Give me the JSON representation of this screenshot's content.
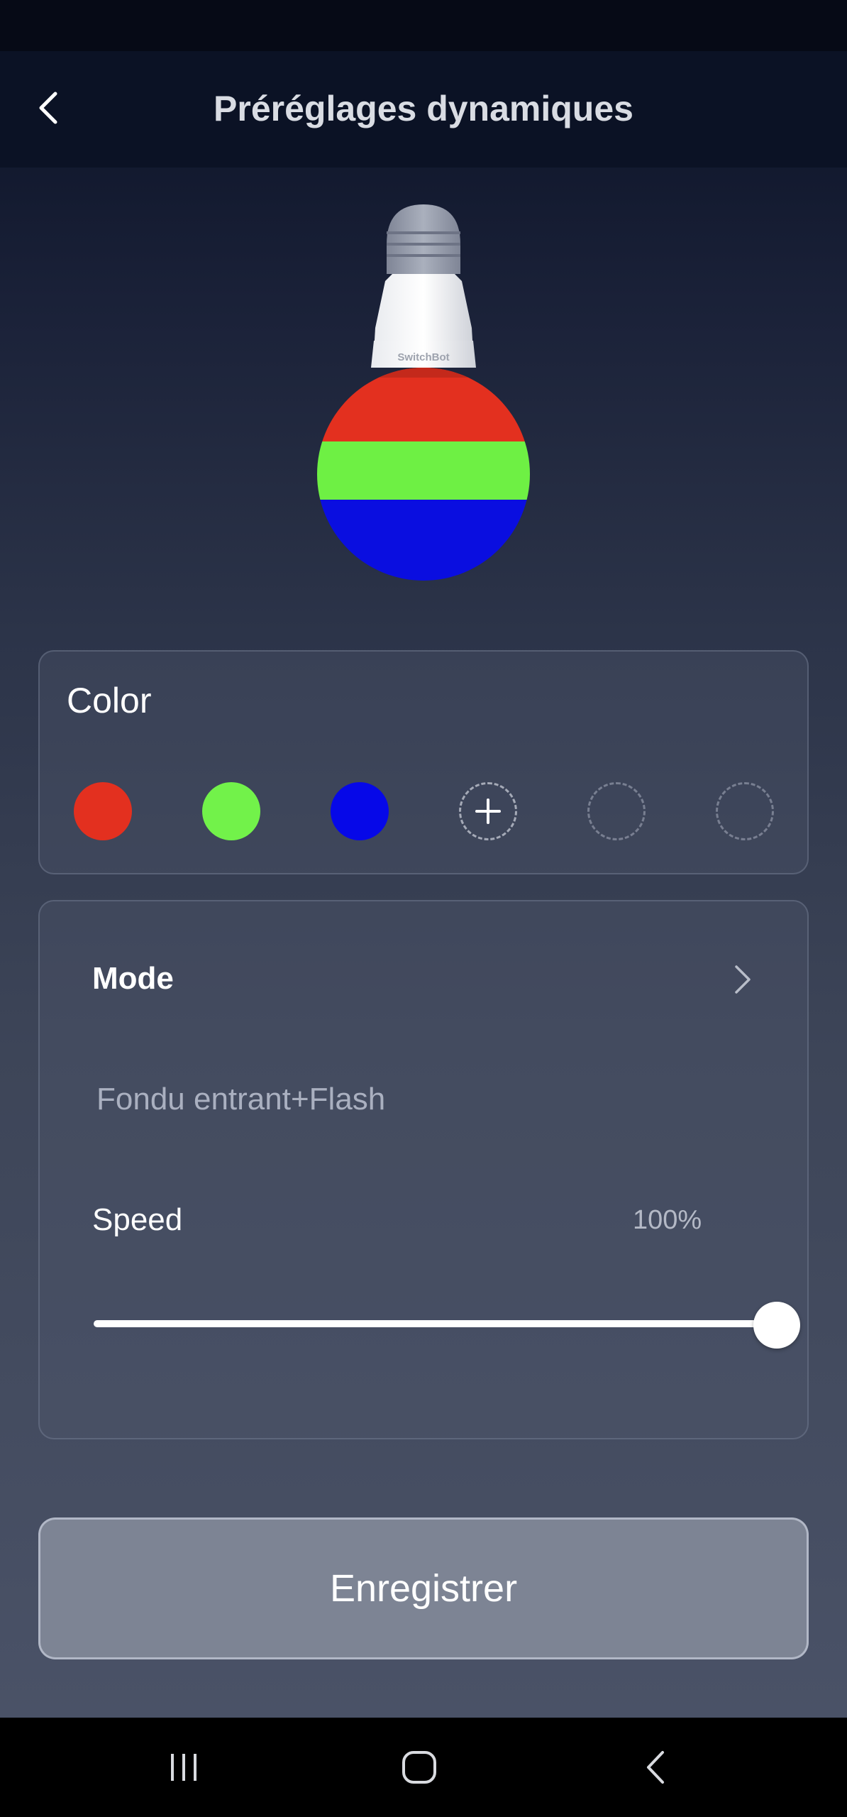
{
  "header": {
    "title": "Préréglages dynamiques",
    "back_icon": "chevron-left-icon"
  },
  "bulb": {
    "brand": "SwitchBot",
    "stripe_colors": [
      "#e3301f",
      "#6ef044",
      "#0a0ee0"
    ]
  },
  "color_card": {
    "title": "Color",
    "swatches": [
      {
        "type": "color",
        "color": "#e3301f"
      },
      {
        "type": "color",
        "color": "#72f24a"
      },
      {
        "type": "color",
        "color": "#0608e8"
      },
      {
        "type": "add",
        "icon": "plus-icon"
      },
      {
        "type": "empty"
      },
      {
        "type": "empty"
      }
    ]
  },
  "mode_card": {
    "mode_label": "Mode",
    "mode_value": "Fondu entrant+Flash",
    "speed_label": "Speed",
    "speed_value": "100%",
    "speed_fraction": 1.0
  },
  "save_label": "Enregistrer",
  "nav": {
    "recent_icon": "recent-apps-icon",
    "home_icon": "home-icon",
    "back_icon": "back-icon"
  }
}
